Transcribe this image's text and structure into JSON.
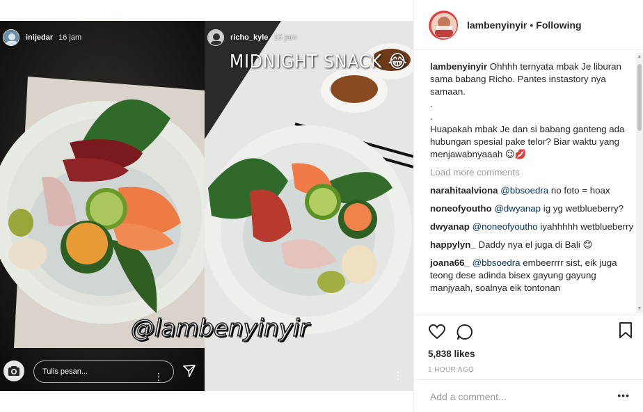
{
  "stories": {
    "left": {
      "username": "inijedar",
      "time": "16 jam",
      "reply_placeholder": "Tulis pesan...",
      "watermark": "@lambenyinyir"
    },
    "right": {
      "username": "richo_kyle",
      "time": "16 jam",
      "caption": "MIDNIGHT SNACK 😂"
    }
  },
  "post": {
    "username": "lambenyinyir",
    "separator": "•",
    "follow_status": "Following",
    "caption": {
      "user": "lambenyinyir",
      "lines": [
        "Ohhhh ternyata mbak Je liburan sama babang Richo. Pantes instastory nya samaan.",
        ".",
        ".",
        "Huapakah mbak Je dan si babang ganteng ada hubungan spesial pake telor? Biar waktu yang menjawabnyaaah 😉💋"
      ]
    },
    "load_more": "Load more comments",
    "comments": [
      {
        "user": "narahitaalviona",
        "mention": "@bbsoedra",
        "text": " no foto = hoax"
      },
      {
        "user": "noneofyoutho",
        "mention": "@dwyanap",
        "text": " ig yg wetblueberry?"
      },
      {
        "user": "dwyanap",
        "mention": "@noneofyoutho",
        "text": " iyahhhhh wetblueberry"
      },
      {
        "user": "happylyn_",
        "mention": "",
        "text": "Daddy nya el juga di Bali 😊"
      },
      {
        "user": "joana66_",
        "mention": "@bbsoedra",
        "text": " embeerrrr sist, eik juga teong dese adinda bisex gayung gayung manjyaah, soalnya eik tontonan"
      }
    ],
    "likes": "5,838 likes",
    "timestamp": "1 HOUR AGO",
    "add_comment_placeholder": "Add a comment...",
    "more_label": "•••"
  },
  "icons": {
    "heart": "heart-icon",
    "comment": "comment-icon",
    "bookmark": "bookmark-icon",
    "camera": "camera-icon",
    "send": "send-icon"
  },
  "colors": {
    "mention": "#003569",
    "muted": "#999999",
    "text": "#262626"
  }
}
